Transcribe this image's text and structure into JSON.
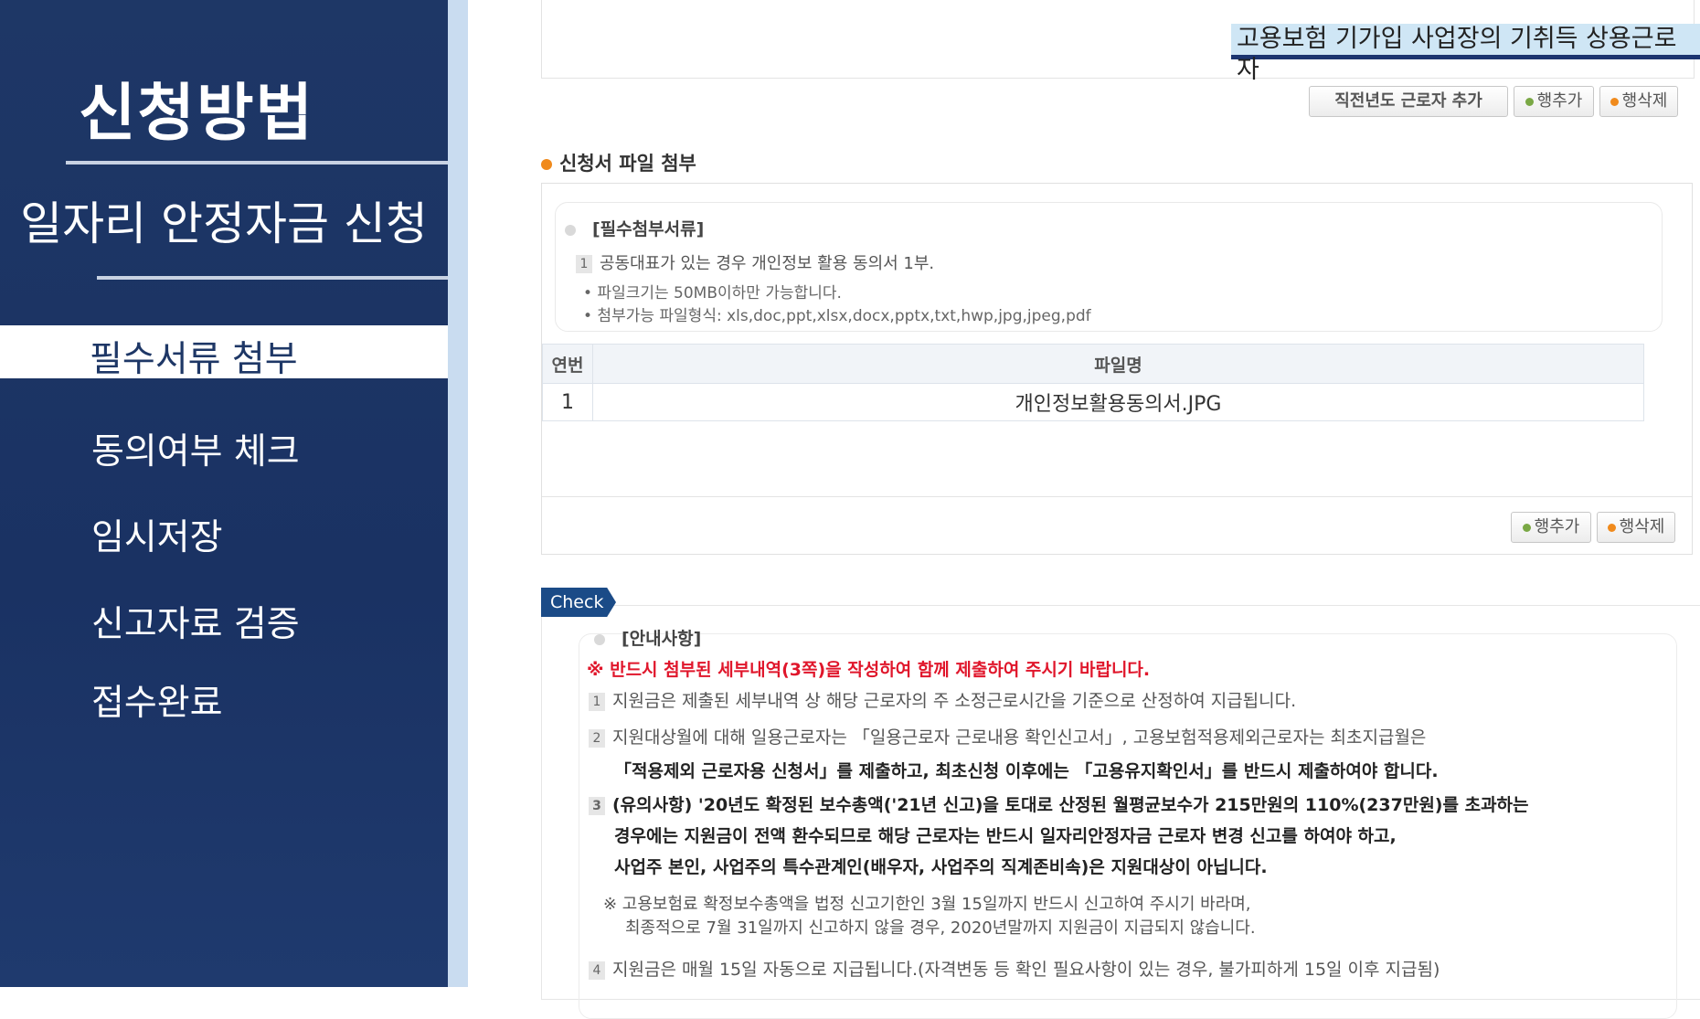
{
  "sidebar": {
    "title": "신청방법",
    "subtitle": "일자리 안정자금 신청",
    "items": [
      {
        "label": "필수서류 첨부",
        "active": true
      },
      {
        "label": "동의여부 체크"
      },
      {
        "label": "임시저장"
      },
      {
        "label": "신고자료 검증"
      },
      {
        "label": "접수완료"
      }
    ]
  },
  "top": {
    "highlight_text": "고용보험 기가입 사업장의 기취득 상용근로자",
    "btn_prev_year": "직전년도 근로자 추가",
    "btn_add_row": "행추가",
    "btn_del_row": "행삭제"
  },
  "attach": {
    "section_title": "신청서 파일 첨부",
    "required_title": "[필수첨부서류]",
    "req_item_num": "1",
    "req_item_text": "공동대표가 있는 경우 개인정보 활용 동의서 1부.",
    "note_size": "• 파일크기는 50MB이하만 가능합니다.",
    "note_types": "• 첨부가능 파일형식: xls,doc,ppt,xlsx,docx,pptx,txt,hwp,jpg,jpeg,pdf",
    "table_headers": {
      "no": "연번",
      "filename": "파일명"
    },
    "rows": [
      {
        "no": "1",
        "filename": "개인정보활용동의서.JPG"
      }
    ],
    "btn_add_row": "행추가",
    "btn_del_row": "행삭제"
  },
  "check": {
    "tag": "Check",
    "title": "[안내사항]",
    "warning": "※ 반드시 첨부된 세부내역(3쪽)을 작성하여 함께 제출하여 주시기 바랍니다.",
    "item1": "지원금은 제출된 세부내역 상 해당 근로자의 주 소정근로시간을 기준으로 산정하여 지급됩니다.",
    "item2_a": "지원대상월에 대해 일용근로자는 「일용근로자 근로내용 확인신고서」, 고용보험적용제외근로자는 최초지급월은",
    "item2_b": "「적용제외 근로자용 신청서」를 제출하고, 최초신청 이후에는 「고용유지확인서」를 반드시 제출하여야 합니다.",
    "item3_a": "(유의사항) '20년도 확정된 보수총액('21년 신고)을 토대로 산정된 월평균보수가 215만원의 110%(237만원)를 초과하는",
    "item3_b": "경우에는 지원금이 전액 환수되므로 해당 근로자는 반드시 일자리안정자금 근로자 변경 신고를 하여야 하고,",
    "item3_c": "사업주 본인, 사업주의 특수관계인(배우자, 사업주의 직계존비속)은 지원대상이 아닙니다.",
    "note_a": "※ 고용보험료 확정보수총액을 법정 신고기한인 3월 15일까지 반드시 신고하여 주시기 바라며,",
    "note_b": "최종적으로 7월 31일까지 신고하지 않을 경우, 2020년말까지 지원금이 지급되지 않습니다.",
    "item4": "지원금은 매월 15일 자동으로 지급됩니다.(자격변동 등 확인 필요사항이 있는 경우, 불가피하게 15일 이후 지급됨)",
    "nums": [
      "1",
      "2",
      "3",
      "4"
    ]
  }
}
